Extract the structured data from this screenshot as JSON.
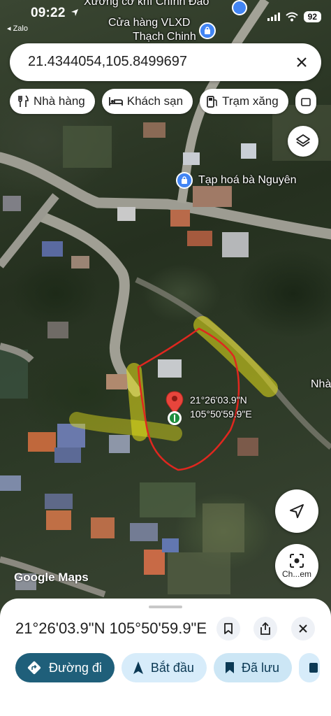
{
  "status_bar": {
    "time": "09:22",
    "back_app": "◂ Zalo",
    "battery": "92"
  },
  "search": {
    "query": "21.4344054,105.8499697"
  },
  "chips": [
    {
      "label": "Nhà hàng",
      "icon": "restaurant-icon"
    },
    {
      "label": "Khách sạn",
      "icon": "hotel-icon"
    },
    {
      "label": "Trạm xăng",
      "icon": "gas-station-icon"
    }
  ],
  "map": {
    "labels": {
      "top_partial": "Xưởng cơ khí Chính Đào",
      "store_line1": "Cửa hàng VLXD",
      "store_line2": "Thạch Chinh",
      "grocery": "Tạp hoá bà Nguyên",
      "right_edge": "Nhà"
    },
    "pin_coordinates": "21°26'03.9\"N\n105°50'59.9\"E",
    "attribution": "Google Maps",
    "lens_label": "Ch...em",
    "colors": {
      "drawn_outline": "#e0271f",
      "highlighter": "#e7e21a",
      "pin": "#e8453c"
    }
  },
  "sheet": {
    "title": "21°26'03.9\"N 105°50'59.9\"E",
    "actions": [
      {
        "label": "Đường đi",
        "icon": "directions-icon"
      },
      {
        "label": "Bắt đầu",
        "icon": "navigation-arrow-icon"
      },
      {
        "label": "Đã lưu",
        "icon": "bookmark-filled-icon"
      }
    ]
  }
}
